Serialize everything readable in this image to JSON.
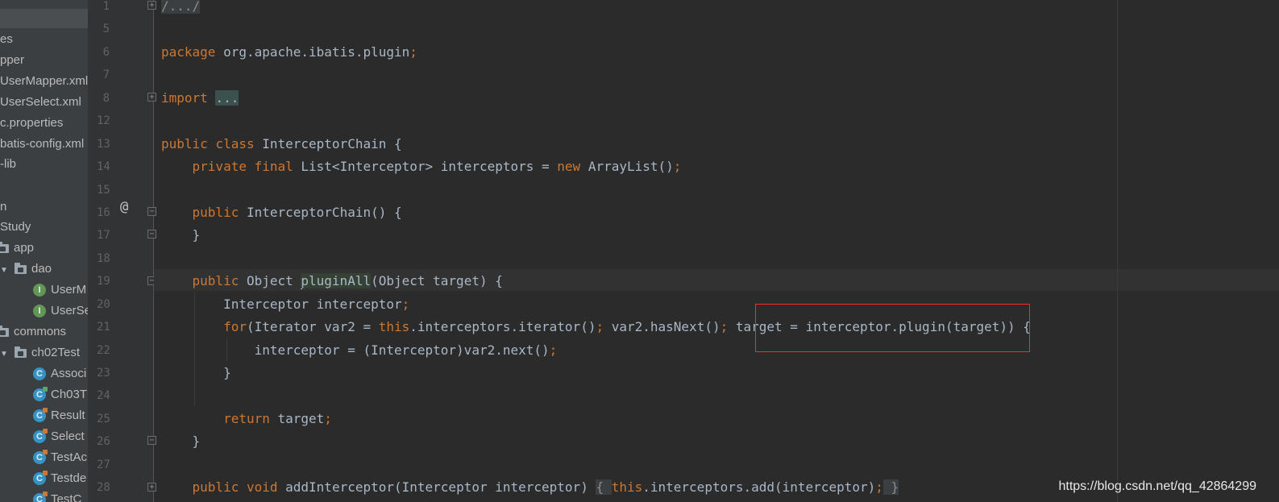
{
  "project_tree": {
    "items": [
      {
        "label": "es",
        "kind": "text"
      },
      {
        "label": "pper",
        "kind": "text"
      },
      {
        "label": "UserMapper.xml",
        "kind": "text"
      },
      {
        "label": "UserSelect.xml",
        "kind": "text"
      },
      {
        "label": "c.properties",
        "kind": "text"
      },
      {
        "label": "batis-config.xml",
        "kind": "text"
      },
      {
        "label": "-lib",
        "kind": "text"
      },
      {
        "label": "n",
        "kind": "text"
      },
      {
        "label": "Study",
        "kind": "text"
      },
      {
        "label": "app",
        "kind": "folder"
      },
      {
        "label": "dao",
        "kind": "folder-expanded"
      },
      {
        "label": "UserM",
        "kind": "interface"
      },
      {
        "label": "UserSe",
        "kind": "interface"
      },
      {
        "label": "commons",
        "kind": "folder"
      },
      {
        "label": "ch02Test",
        "kind": "folder-expanded"
      },
      {
        "label": "Associ",
        "kind": "class"
      },
      {
        "label": "Ch03T",
        "kind": "class"
      },
      {
        "label": "Result",
        "kind": "class"
      },
      {
        "label": "Select",
        "kind": "class"
      },
      {
        "label": "TestAc",
        "kind": "class"
      },
      {
        "label": "Testde",
        "kind": "class"
      },
      {
        "label": "TestC",
        "kind": "class"
      }
    ]
  },
  "gutter": {
    "line_numbers": [
      "1",
      "5",
      "6",
      "7",
      "8",
      "12",
      "13",
      "14",
      "15",
      "16",
      "17",
      "18",
      "19",
      "20",
      "21",
      "22",
      "23",
      "24",
      "25",
      "26",
      "27",
      "28"
    ],
    "override_marker": "@"
  },
  "code": {
    "l1_fold": "/.../",
    "l6_kw": "package",
    "l6_rest": " org.apache.ibatis.plugin",
    "l6_semi": ";",
    "l8_kw": "import",
    "l8_fold": "...",
    "l13_kw": "public class",
    "l13_rest": " InterceptorChain {",
    "l14_kw": "private final",
    "l14_mid": " List<Interceptor> interceptors = ",
    "l14_new": "new",
    "l14_end": " ArrayList()",
    "l14_semi": ";",
    "l16_kw": "public",
    "l16_fn": "InterceptorChain",
    "l16_rest": "() {",
    "l17": "}",
    "l19_kw": "public",
    "l19_mid": " Object ",
    "l19_fn": "pluginAll",
    "l19_rest": "(Object target) {",
    "l20_a": "Interceptor interceptor",
    "l20_semi": ";",
    "l21_kw": "for",
    "l21_a": "(Iterator var2 = ",
    "l21_this": "this",
    "l21_b": ".interceptors.iterator()",
    "l21_s1": ";",
    "l21_c": " var2.hasNext()",
    "l21_s2": ";",
    "l21_d": " target = interceptor.plugin(target)) {",
    "l22_a": "interceptor = (Interceptor)var2.next()",
    "l22_semi": ";",
    "l23": "}",
    "l25_kw": "return",
    "l25_rest": " target",
    "l25_semi": ";",
    "l26": "}",
    "l28_kw": "public void",
    "l28_fn": "addInterceptor",
    "l28_mid": "(Interceptor interceptor) ",
    "l28_b1": "{ ",
    "l28_this": "this",
    "l28_c": ".interceptors.add(interceptor)",
    "l28_semi": ";",
    "l28_b2": " }"
  },
  "watermark": "https://blog.csdn.net/qq_42864299",
  "colors": {
    "background": "#2b2b2b",
    "keyword": "#cc7832",
    "method": "#ffc66d",
    "text": "#a9b7c6",
    "highlight_box": "#ff2a2a"
  }
}
